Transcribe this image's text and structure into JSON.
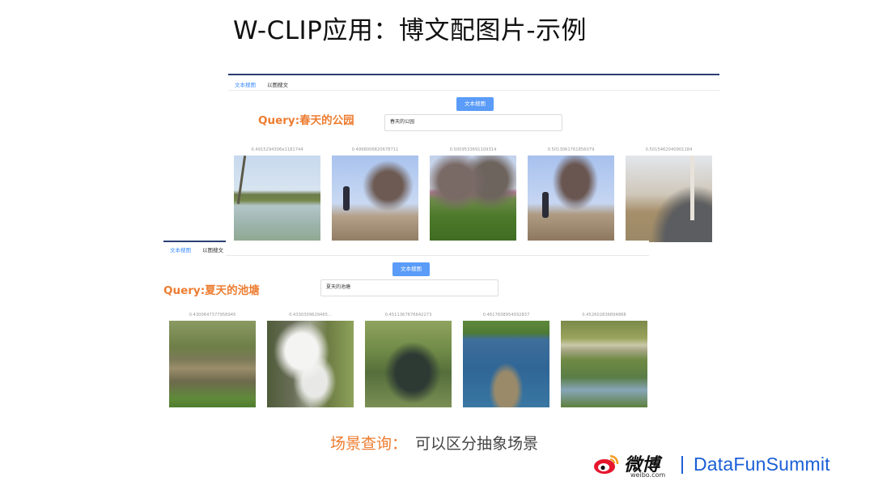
{
  "slide": {
    "title": "W-CLIP应用：博文配图片-示例"
  },
  "panels": [
    {
      "tabs": [
        {
          "label": "文本搜图",
          "active": true
        },
        {
          "label": "以图搜文",
          "active": false
        }
      ],
      "search_button": "文本搜图",
      "query_input": "春天的公园",
      "query_label": "Query:春天的公园",
      "results": [
        {
          "score": "0.4915294306e1181744",
          "image": "pond-lake-icon"
        },
        {
          "score": "0.4998006820678711",
          "image": "man-tree-icon"
        },
        {
          "score": "0.5009533691109314",
          "image": "park-lawn-icon"
        },
        {
          "score": "0.5013061761856079",
          "image": "man-tree-icon"
        },
        {
          "score": "0.5015462040901184",
          "image": "park-path-icon"
        }
      ]
    },
    {
      "tabs": [
        {
          "label": "文本搜图",
          "active": true
        },
        {
          "label": "以图搜文",
          "active": false
        }
      ],
      "search_button": "文本搜图",
      "query_input": "夏天的池塘",
      "query_label": "Query:夏天的池塘",
      "results": [
        {
          "score": "0.4300647377958945",
          "image": "marsh-icon"
        },
        {
          "score": "0.4330309629465...",
          "image": "waterfall-icon"
        },
        {
          "score": "0.4511367676642273",
          "image": "stream-icon"
        },
        {
          "score": "0.4617838954932837",
          "image": "blue-water-icon"
        },
        {
          "score": "0.452602836894868",
          "image": "bridge-icon"
        }
      ]
    }
  ],
  "caption": {
    "key": "场景查询：",
    "value": "可以区分抽象场景"
  },
  "footer": {
    "weibo": "微博",
    "weibo_sub": "weibo.com",
    "summit": "DataFunSummit"
  }
}
